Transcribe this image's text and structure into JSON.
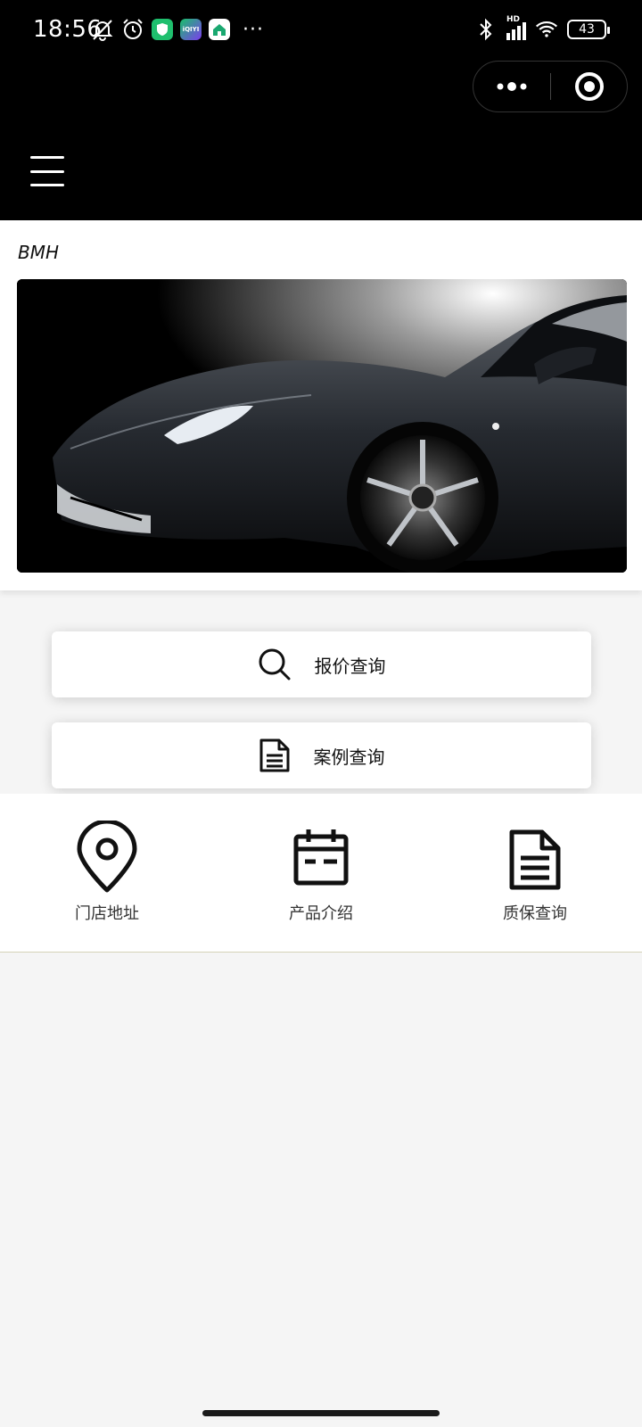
{
  "status_bar": {
    "time": "18:56",
    "overflow": "···",
    "battery": "43",
    "network": "HD"
  },
  "brand": {
    "name": "BMH"
  },
  "banner": {
    "subject": "black sports car"
  },
  "actions": [
    {
      "label": "报价查询",
      "icon": "search-icon"
    },
    {
      "label": "案例查询",
      "icon": "document-icon"
    }
  ],
  "shortcuts": [
    {
      "label": "门店地址",
      "icon": "location-pin-icon"
    },
    {
      "label": "产品介绍",
      "icon": "calendar-icon"
    },
    {
      "label": "质保查询",
      "icon": "document-icon"
    }
  ]
}
